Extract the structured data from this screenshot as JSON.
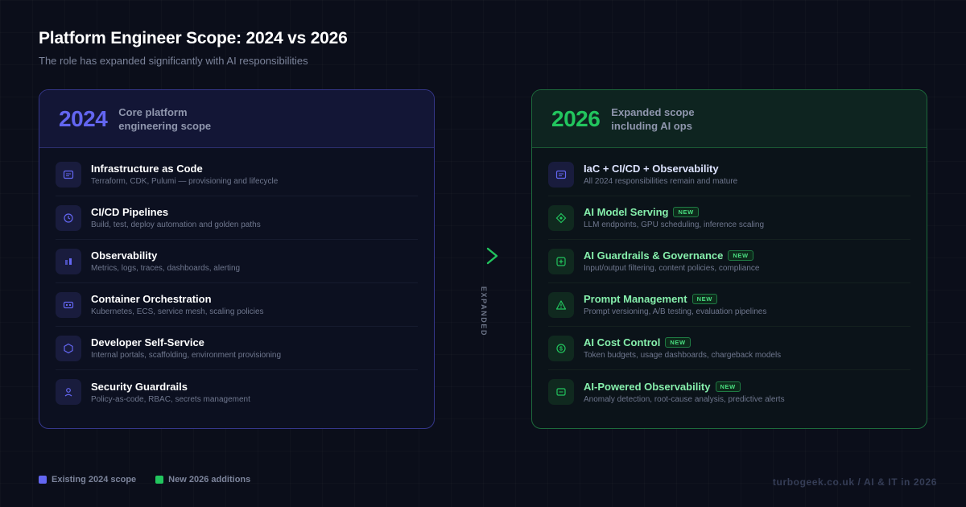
{
  "header": {
    "title": "Platform Engineer Scope: 2024 vs 2026",
    "subtitle": "The role has expanded significantly with AI responsibilities"
  },
  "colors": {
    "indigo": "#6366f1",
    "green": "#22c55e"
  },
  "left_panel": {
    "year": "2024",
    "description": "Core platform engineering scope",
    "items": [
      {
        "title": "Infrastructure as Code",
        "description": "Terraform, CDK, Pulumi — provisioning and lifecycle",
        "icon": "code-window-icon"
      },
      {
        "title": "CI/CD Pipelines",
        "description": "Build, test, deploy automation and golden paths",
        "icon": "clock-icon"
      },
      {
        "title": "Observability",
        "description": "Metrics, logs, traces, dashboards, alerting",
        "icon": "bar-chart-icon"
      },
      {
        "title": "Container Orchestration",
        "description": "Kubernetes, ECS, service mesh, scaling policies",
        "icon": "container-icon"
      },
      {
        "title": "Developer Self-Service",
        "description": "Internal portals, scaffolding, environment provisioning",
        "icon": "hexagon-icon"
      },
      {
        "title": "Security Guardrails",
        "description": "Policy-as-code, RBAC, secrets management",
        "icon": "user-lock-icon"
      }
    ]
  },
  "transition": {
    "label": "EXPANDED",
    "icon": "chevron-right-icon"
  },
  "right_panel": {
    "year": "2026",
    "description": "Expanded scope including AI ops",
    "badge_label": "NEW",
    "items": [
      {
        "title": "IaC + CI/CD + Observability",
        "description": "All 2024 responsibilities remain and mature",
        "icon": "code-window-icon",
        "is_new": false
      },
      {
        "title": "AI Model Serving",
        "description": "LLM endpoints, GPU scheduling, inference scaling",
        "icon": "diamond-icon",
        "is_new": true
      },
      {
        "title": "AI Guardrails & Governance",
        "description": "Input/output filtering, content policies, compliance",
        "icon": "shield-plus-icon",
        "is_new": true
      },
      {
        "title": "Prompt Management",
        "description": "Prompt versioning, A/B testing, evaluation pipelines",
        "icon": "warning-triangle-icon",
        "is_new": true
      },
      {
        "title": "AI Cost Control",
        "description": "Token budgets, usage dashboards, chargeback models",
        "icon": "dollar-coin-icon",
        "is_new": true
      },
      {
        "title": "AI-Powered Observability",
        "description": "Anomaly detection, root-cause analysis, predictive alerts",
        "icon": "monitor-icon",
        "is_new": true
      }
    ]
  },
  "legend": {
    "existing": "Existing 2024 scope",
    "new": "New 2026 additions"
  },
  "footer": "turbogeek.co.uk / AI & IT in 2026"
}
